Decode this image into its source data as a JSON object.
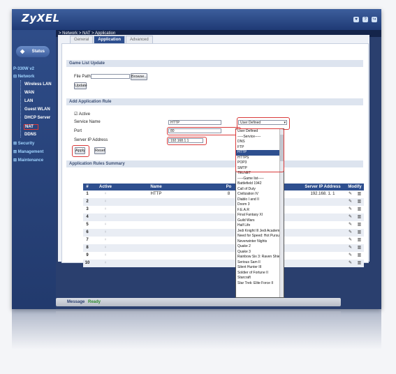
{
  "brand": "ZyXEL",
  "breadcrumb": "> Network > NAT > Application",
  "sidebar": {
    "status_label": "Status",
    "model": "P-330W v2",
    "groups": [
      {
        "label": "Network"
      },
      {
        "label": "Security"
      },
      {
        "label": "Management"
      },
      {
        "label": "Maintenance"
      }
    ],
    "items": [
      {
        "label": "Wireless LAN"
      },
      {
        "label": "WAN"
      },
      {
        "label": "LAN"
      },
      {
        "label": "Guest WLAN"
      },
      {
        "label": "DHCP Server"
      },
      {
        "label": "NAT"
      },
      {
        "label": "DDNS"
      }
    ]
  },
  "tabs": [
    {
      "label": "General"
    },
    {
      "label": "Application"
    },
    {
      "label": "Advanced"
    }
  ],
  "game_list": {
    "section_title": "Game List Update",
    "file_path_label": "File Path:",
    "file_path_value": "",
    "browse_label": "Browse...",
    "update_label": "Update"
  },
  "add_rule": {
    "section_title": "Add Application Rule",
    "active_label": "Active",
    "service_name_label": "Service Name",
    "service_name_value": "HTTP",
    "service_select_value": "User Defined",
    "port_label": "Port",
    "port_value": "80",
    "server_ip_label": "Server IP Address",
    "server_ip_value": "192.168.1.1",
    "apply_label": "Apply",
    "reset_label": "Reset"
  },
  "dropdown_options": [
    "User Defined",
    "-----Service-----",
    "DNS",
    "FTP",
    "HTTP",
    "HTTPS",
    "POP3",
    "SMTP",
    "TELNET",
    "-----Game list-----",
    "Battlefield 1942",
    "Call of Duty",
    "Civilization IV",
    "Diablo I and II",
    "Doom 3",
    "F.E.A.R",
    "Final Fantasy XI",
    "Guild Wars",
    "Half Life",
    "Jedi Knight III Jedi Academy",
    "Need for Speed: Hot Pursuit 2",
    "Neverwinter Nights",
    "Quake 2",
    "Quake 3",
    "Rainbow Six 3: Raven Shield",
    "Serious Sam II",
    "Silent Hunter III",
    "Soldier of Fortune II",
    "Starcraft",
    "Star Trek: Elite Force II"
  ],
  "dropdown_selected": "HTTP",
  "summary": {
    "section_title": "Application Rules Summary",
    "columns": [
      "#",
      "Active",
      "Name",
      "Po",
      "Server IP Address",
      "Modify"
    ],
    "rows": [
      {
        "num": "1",
        "name": "HTTP",
        "port": "8",
        "ip": "192.168. 1. 1"
      },
      {
        "num": "2",
        "name": "",
        "port": "",
        "ip": ""
      },
      {
        "num": "3",
        "name": "",
        "port": "",
        "ip": ""
      },
      {
        "num": "4",
        "name": "",
        "port": "",
        "ip": ""
      },
      {
        "num": "5",
        "name": "",
        "port": "",
        "ip": ""
      },
      {
        "num": "6",
        "name": "",
        "port": "",
        "ip": ""
      },
      {
        "num": "7",
        "name": "",
        "port": "",
        "ip": ""
      },
      {
        "num": "8",
        "name": "",
        "port": "",
        "ip": ""
      },
      {
        "num": "9",
        "name": "",
        "port": "",
        "ip": ""
      },
      {
        "num": "10",
        "name": "",
        "port": "",
        "ip": ""
      }
    ]
  },
  "message": {
    "label": "Message",
    "value": "Ready"
  },
  "icons": {
    "status": "status-icon",
    "bulb": "lightbulb-icon",
    "edit": "edit-icon",
    "delete": "trash-icon",
    "checkbox": "checkbox-icon"
  },
  "colors": {
    "navy": "#2a3f6e",
    "highlight": "#d93a3a",
    "ready": "#2d8a2d"
  }
}
